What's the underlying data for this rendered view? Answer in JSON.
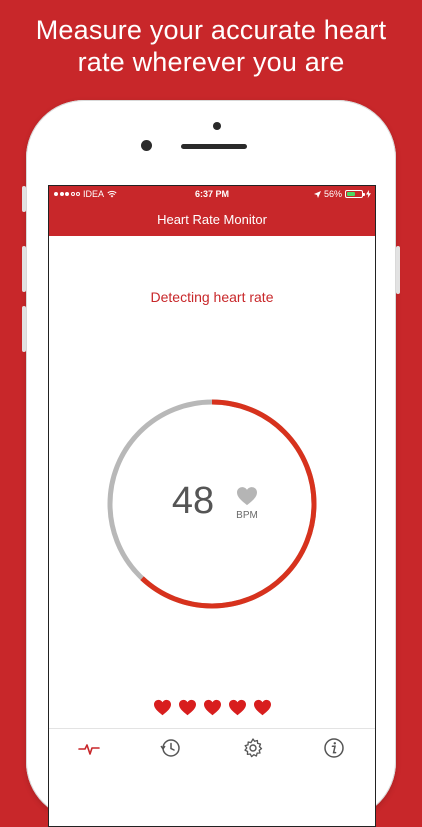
{
  "headline": {
    "line1": "Measure your accurate heart",
    "line2": "rate wherever you are"
  },
  "status_bar": {
    "carrier": "IDEA",
    "time": "6:37 PM",
    "battery": "56%",
    "battery_level": 0.56
  },
  "nav": {
    "title": "Heart Rate Monitor"
  },
  "measurement": {
    "status": "Detecting heart rate",
    "bpm": "48",
    "unit": "BPM",
    "progress": 0.62
  },
  "hearts_count": 5,
  "tabs": [
    {
      "icon": "heartbeat-icon",
      "active": true
    },
    {
      "icon": "history-clock-icon",
      "active": false
    },
    {
      "icon": "gear-icon",
      "active": false
    },
    {
      "icon": "info-icon",
      "active": false
    }
  ],
  "colors": {
    "brand": "#c8272a",
    "ring_active": "#d7321d",
    "ring_track": "#b8b8b8",
    "heart": "#d81e1e"
  }
}
